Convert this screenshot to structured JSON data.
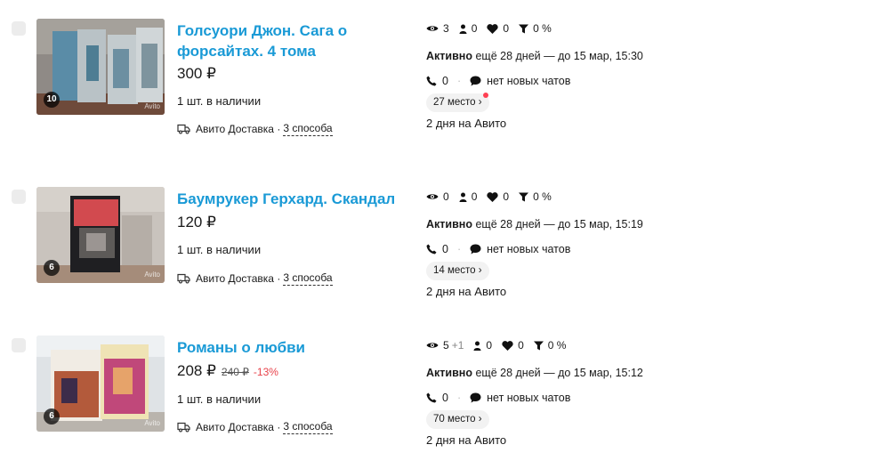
{
  "listings": [
    {
      "title": "Голсуори Джон. Сага о форсайтах. 4 тома",
      "price": "300 ₽",
      "old_price": "",
      "discount": "",
      "stock": "1 шт. в наличии",
      "delivery": "Авито Доставка ·",
      "delivery_ways": "3 способа",
      "photo_count": "10",
      "watermark": "Avito",
      "views": "3",
      "views_plus": "",
      "contacts": "0",
      "favorites": "0",
      "conversion": "0 %",
      "status": "Активно",
      "status_detail": "ещё 28 дней — до 15 мар, 15:30",
      "calls": "0",
      "chats": "нет новых чатов",
      "place": "27 место ›",
      "place_has_dot": true,
      "days_on_avito": "2 дня на Авито"
    },
    {
      "title": "Баумрукер Герхард. Скандал",
      "price": "120 ₽",
      "old_price": "",
      "discount": "",
      "stock": "1 шт. в наличии",
      "delivery": "Авито Доставка ·",
      "delivery_ways": "3 способа",
      "photo_count": "6",
      "watermark": "Avito",
      "views": "0",
      "views_plus": "",
      "contacts": "0",
      "favorites": "0",
      "conversion": "0 %",
      "status": "Активно",
      "status_detail": "ещё 28 дней — до 15 мар, 15:19",
      "calls": "0",
      "chats": "нет новых чатов",
      "place": "14 место ›",
      "place_has_dot": false,
      "days_on_avito": "2 дня на Авито"
    },
    {
      "title": "Романы о любви",
      "price": "208 ₽",
      "old_price": "240 ₽",
      "discount": "-13%",
      "stock": "1 шт. в наличии",
      "delivery": "Авито Доставка ·",
      "delivery_ways": "3 способа",
      "photo_count": "6",
      "watermark": "Avito",
      "views": "5",
      "views_plus": "+1",
      "contacts": "0",
      "favorites": "0",
      "conversion": "0 %",
      "status": "Активно",
      "status_detail": "ещё 28 дней — до 15 мар, 15:12",
      "calls": "0",
      "chats": "нет новых чатов",
      "place": "70 место ›",
      "place_has_dot": false,
      "days_on_avito": "2 дня на Авито"
    }
  ],
  "colors": {
    "title": "#1a9ad6",
    "discount": "#e8424a",
    "badge_bg": "#f2f2f2",
    "dot": "#ff4053"
  },
  "icons": [
    "eye-icon",
    "person-icon",
    "heart-icon",
    "funnel-icon",
    "phone-icon",
    "chat-icon",
    "truck-icon"
  ]
}
